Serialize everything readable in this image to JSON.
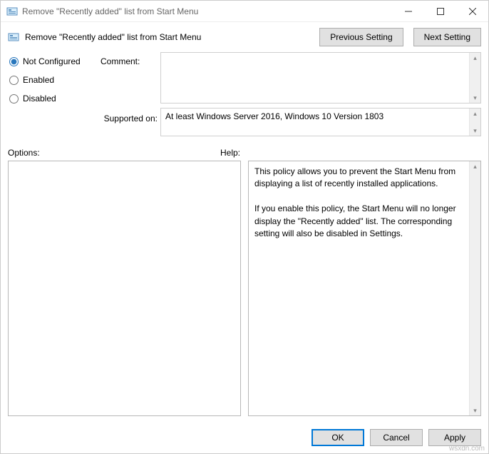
{
  "window": {
    "title": "Remove \"Recently added\" list from Start Menu"
  },
  "header": {
    "title": "Remove \"Recently added\" list from Start Menu",
    "prev": "Previous Setting",
    "next": "Next Setting"
  },
  "radios": {
    "not_configured": "Not Configured",
    "enabled": "Enabled",
    "disabled": "Disabled",
    "selected": "not_configured"
  },
  "labels": {
    "comment": "Comment:",
    "supported": "Supported on:",
    "options": "Options:",
    "help": "Help:"
  },
  "comment": "",
  "supported": "At least Windows Server 2016, Windows 10 Version 1803",
  "help": {
    "p1": "This policy allows you to prevent the Start Menu from displaying a list of recently installed applications.",
    "p2": "If you enable this policy, the Start Menu will no longer display the \"Recently added\" list.  The corresponding setting will also be disabled in Settings."
  },
  "footer": {
    "ok": "OK",
    "cancel": "Cancel",
    "apply": "Apply"
  },
  "watermark": "wsxdn.com"
}
